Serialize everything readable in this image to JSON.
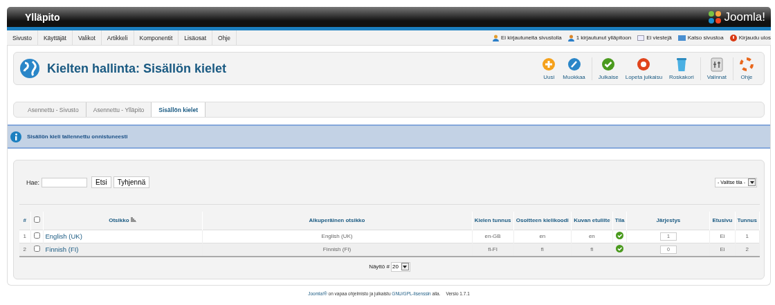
{
  "header": {
    "title": "Ylläpito",
    "logo_text": "Joomla!"
  },
  "menu": [
    {
      "label": "Sivusto"
    },
    {
      "label": "Käyttäjät"
    },
    {
      "label": "Valikot"
    },
    {
      "label": "Artikkeli"
    },
    {
      "label": "Komponentit"
    },
    {
      "label": "Lisäosat"
    },
    {
      "label": "Ohje"
    }
  ],
  "status": [
    {
      "kind": "users",
      "label": "Ei kirjautuneita sivustolla"
    },
    {
      "kind": "admin",
      "label": "1 kirjautunut ylläpitoon"
    },
    {
      "kind": "mail",
      "label": "Ei viestejä"
    },
    {
      "kind": "view",
      "label": "Katso sivustoa"
    },
    {
      "kind": "logout",
      "label": "Kirjaudu ulos"
    }
  ],
  "page_title": "Kielten hallinta: Sisällön kielet",
  "toolbar": [
    [
      {
        "kind": "new",
        "label": "Uusi"
      },
      {
        "kind": "edit",
        "label": "Muokkaa"
      }
    ],
    [
      {
        "kind": "publish",
        "label": "Julkaise"
      },
      {
        "kind": "unpublish",
        "label": "Lopeta julkaisu"
      },
      {
        "kind": "trash",
        "label": "Roskakori"
      }
    ],
    [
      {
        "kind": "options",
        "label": "Valinnat"
      }
    ],
    [
      {
        "kind": "help",
        "label": "Ohje"
      }
    ]
  ],
  "subtabs": [
    {
      "label": "Asennettu - Sivusto",
      "selected": false
    },
    {
      "label": "Asennettu - Ylläpito",
      "selected": false
    },
    {
      "label": "Sisällön kielet",
      "selected": true
    }
  ],
  "message": "Sisällön kieli tallennettu onnistuneesti",
  "filter": {
    "label": "Hae:",
    "search_button": "Etsi",
    "clear_button": "Tyhjennä",
    "state_select": "- Valitse tila -"
  },
  "table": {
    "select_all_checked": false,
    "columns": [
      "#",
      "Otsikko",
      "Alkuperäinen otsikko",
      "Kielen tunnus",
      "Osoitteen kielikoodi",
      "Kuvan etuliite",
      "Tila",
      "Järjestys",
      "Etusivu",
      "Tunnus"
    ],
    "rows": [
      {
        "num": "1",
        "checked": false,
        "title": "English (UK)",
        "original": "English (UK)",
        "tag": "en-GB",
        "sef": "en",
        "image": "en",
        "published": true,
        "ordering": "1",
        "home": "Ei",
        "id": "1"
      },
      {
        "num": "2",
        "checked": false,
        "title": "Finnish (FI)",
        "original": "Finnish (FI)",
        "tag": "fi-FI",
        "sef": "fi",
        "image": "fi",
        "published": true,
        "ordering": "0",
        "home": "Ei",
        "id": "2"
      }
    ]
  },
  "pagination": {
    "label": "Näyttö #",
    "value": "20"
  },
  "footer": {
    "parts": [
      {
        "kind": "link",
        "text": "Joomla!®"
      },
      {
        "kind": "text",
        "text": " on vapaa ohjelmisto ja julkaistu "
      },
      {
        "kind": "link",
        "text": "GNU/GPL-lisenssin"
      },
      {
        "kind": "text",
        "text": " alla."
      }
    ],
    "version": "Versio 1.7.1"
  }
}
